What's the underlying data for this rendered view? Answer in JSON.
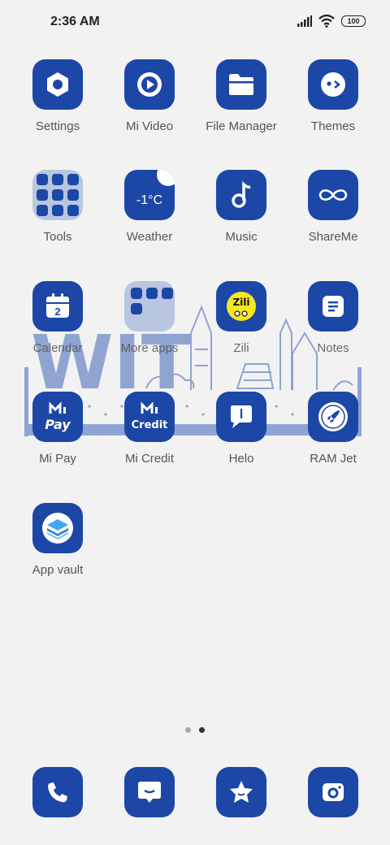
{
  "status": {
    "time": "2:36 AM",
    "battery": "100"
  },
  "apps": {
    "settings": "Settings",
    "mi_video": "Mi Video",
    "file_manager": "File Manager",
    "themes": "Themes",
    "tools": "Tools",
    "weather": "Weather",
    "weather_temp": "-1°C",
    "music": "Music",
    "shareme": "ShareMe",
    "calendar": "Calendar",
    "calendar_day": "2",
    "more_apps": "More apps",
    "zili": "Zili",
    "zili_logo": "Zili",
    "notes": "Notes",
    "mi_pay": "Mi Pay",
    "mi_pay_text": "Pay",
    "mi_credit": "Mi Credit",
    "mi_credit_text": "Credit",
    "helo": "Helo",
    "ram_jet": "RAM Jet",
    "app_vault": "App vault"
  },
  "wallpaper": {
    "text": "WIT"
  },
  "page_indicator": {
    "count": 2,
    "active": 2
  },
  "dock": [
    "phone-icon",
    "messages-icon",
    "star-face-icon",
    "camera-icon"
  ],
  "colors": {
    "accent": "#1c47a6",
    "background": "#f2f2f2",
    "wallpaper": "#7f96cc"
  }
}
